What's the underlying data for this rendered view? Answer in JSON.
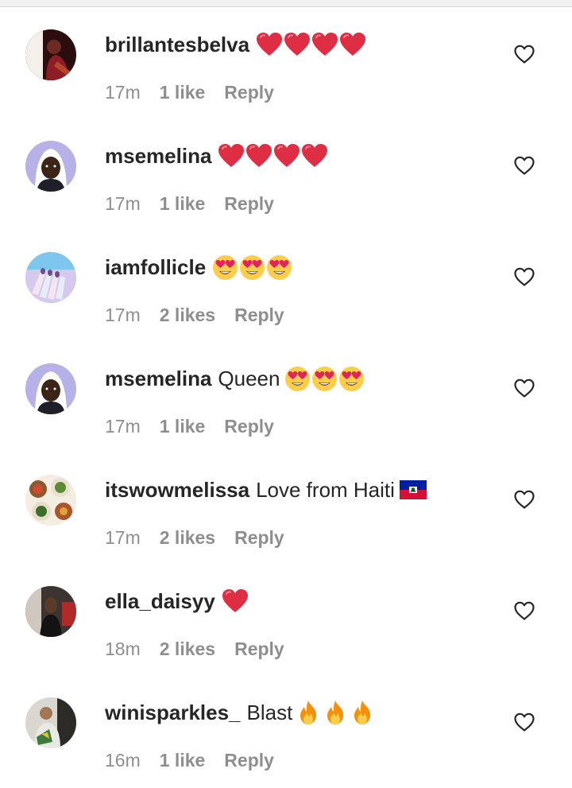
{
  "comments": [
    {
      "username": "brillantesbelva",
      "text": "",
      "emojis": [
        "red-heart",
        "red-heart",
        "red-heart",
        "red-heart"
      ],
      "time": "17m",
      "likes": "1 like",
      "reply": "Reply",
      "avatar": "avatar-dark-red"
    },
    {
      "username": "msemelina",
      "text": "",
      "emojis": [
        "red-heart",
        "red-heart",
        "red-heart",
        "red-heart"
      ],
      "time": "17m",
      "likes": "1 like",
      "reply": "Reply",
      "avatar": "avatar-lavender-person"
    },
    {
      "username": "iamfollicle",
      "text": "",
      "emojis": [
        "heart-eyes",
        "heart-eyes",
        "heart-eyes"
      ],
      "time": "17m",
      "likes": "2 likes",
      "reply": "Reply",
      "avatar": "avatar-blue-nails"
    },
    {
      "username": "msemelina",
      "text": "Queen",
      "emojis": [
        "heart-eyes",
        "heart-eyes",
        "heart-eyes"
      ],
      "time": "17m",
      "likes": "1 like",
      "reply": "Reply",
      "avatar": "avatar-lavender-person"
    },
    {
      "username": "itswowmelissa",
      "text": "Love from Haiti",
      "emojis": [
        "haiti-flag"
      ],
      "time": "17m",
      "likes": "2 likes",
      "reply": "Reply",
      "avatar": "avatar-food"
    },
    {
      "username": "ella_daisyy",
      "text": "",
      "emojis": [
        "red-heart"
      ],
      "time": "18m",
      "likes": "2 likes",
      "reply": "Reply",
      "avatar": "avatar-dark-person"
    },
    {
      "username": "winisparkles_",
      "text": "Blast",
      "emojis": [
        "fire",
        "fire",
        "fire"
      ],
      "time": "16m",
      "likes": "1 like",
      "reply": "Reply",
      "avatar": "avatar-outdoor"
    }
  ],
  "colors": {
    "username": "#262626",
    "meta": "#8e8e8e",
    "heart_outline": "#262626",
    "red_heart": "#dd2e44"
  },
  "icons": {
    "like": "heart-outline-icon"
  }
}
